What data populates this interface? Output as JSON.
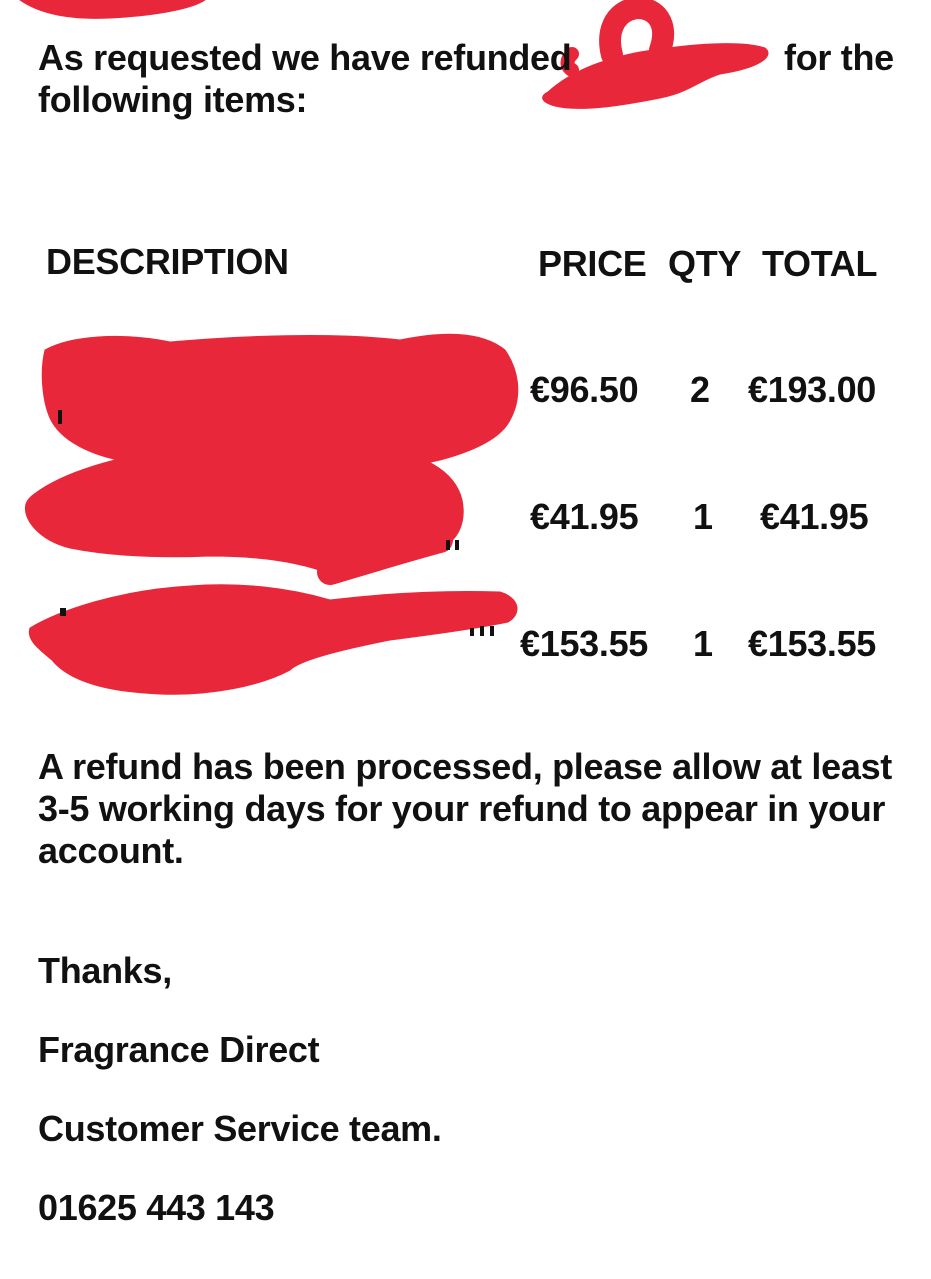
{
  "intro": {
    "prefix": "As requested we have refunded",
    "suffix": "for the",
    "line2": "following items:"
  },
  "table": {
    "headers": {
      "description": "DESCRIPTION",
      "price": "PRICE",
      "qty": "QTY",
      "total": "TOTAL"
    },
    "rows": [
      {
        "price": "€96.50",
        "qty": "2",
        "total": "€193.00"
      },
      {
        "price": "€41.95",
        "qty": "1",
        "total": "€41.95"
      },
      {
        "price": "€153.55",
        "qty": "1",
        "total": "€153.55"
      }
    ]
  },
  "refund_note": {
    "line1": "A refund has been processed, please allow at least",
    "line2": "3-5 working days for your refund to appear in your",
    "line3": "account."
  },
  "signoff": {
    "thanks": "Thanks,",
    "company": "Fragrance Direct",
    "team": "Customer Service team.",
    "phone": "01625 443 143"
  },
  "colors": {
    "redaction": "#e8283a",
    "text": "#111111",
    "background": "#ffffff"
  }
}
